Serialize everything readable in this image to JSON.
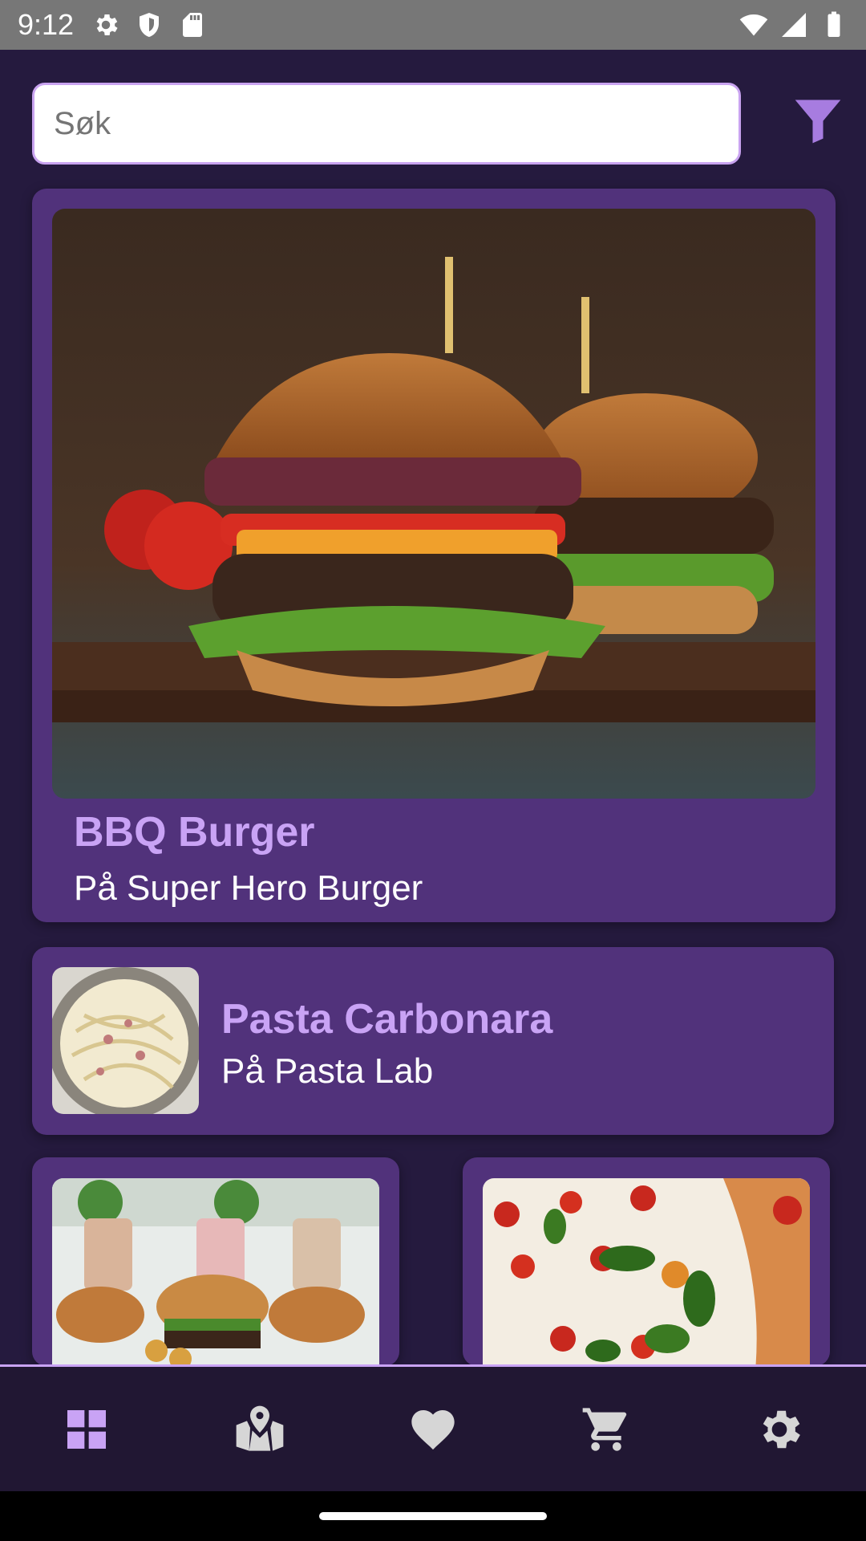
{
  "status_bar": {
    "time": "9:12",
    "icons": [
      "settings-icon",
      "shield-icon",
      "sd-card-icon",
      "wifi-icon",
      "signal-icon",
      "battery-icon"
    ]
  },
  "search": {
    "placeholder": "Søk"
  },
  "filter": {
    "icon": "filter-icon"
  },
  "cards": [
    {
      "title": "BBQ Burger",
      "subtitle": "På Super Hero Burger",
      "image": "burger-photo"
    },
    {
      "title": "Pasta Carbonara",
      "subtitle": "På Pasta Lab",
      "image": "pasta-photo"
    },
    {
      "title": "",
      "subtitle": "",
      "image": "burgers-and-shakes-photo"
    },
    {
      "title": "",
      "subtitle": "",
      "image": "pizza-photo"
    }
  ],
  "bottom_nav": {
    "items": [
      {
        "name": "dashboard",
        "icon": "grid-icon",
        "active": true
      },
      {
        "name": "map",
        "icon": "map-icon",
        "active": false
      },
      {
        "name": "favorites",
        "icon": "heart-icon",
        "active": false
      },
      {
        "name": "cart",
        "icon": "cart-icon",
        "active": false
      },
      {
        "name": "settings",
        "icon": "gear-icon",
        "active": false
      }
    ]
  },
  "colors": {
    "background": "#251a3e",
    "card": "#51327b",
    "accent": "#c9a3f5",
    "nav_inactive": "#d6d6d6"
  }
}
